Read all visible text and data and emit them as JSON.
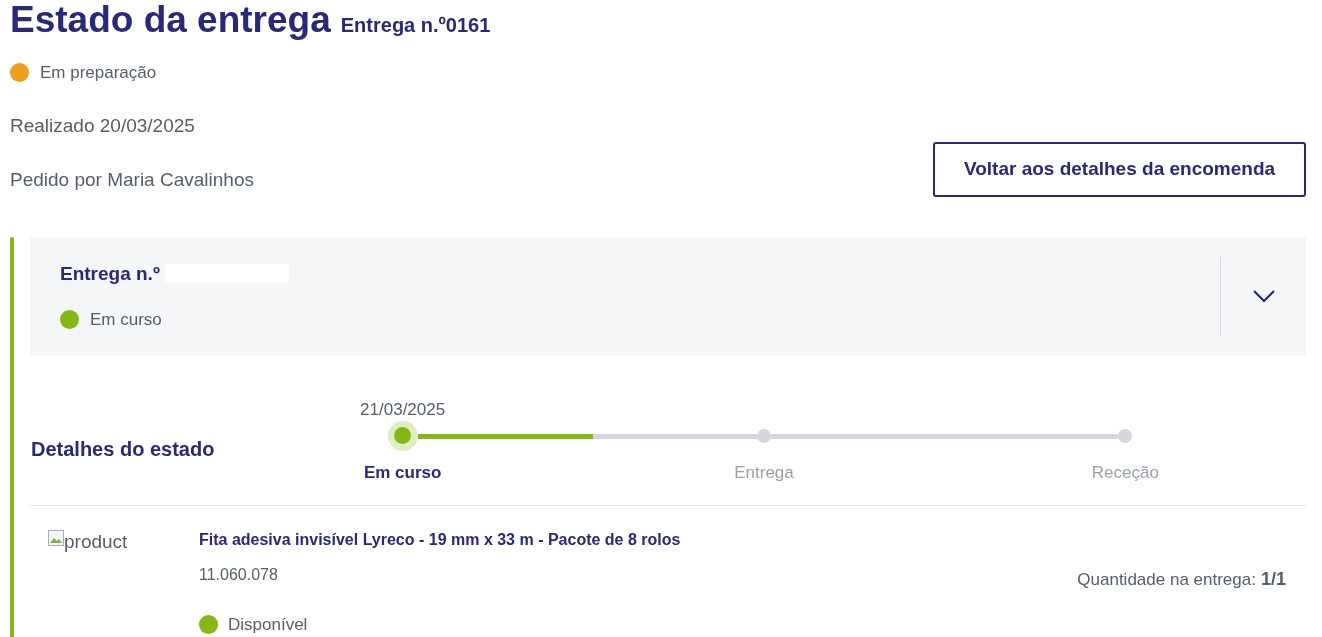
{
  "header": {
    "title": "Estado da entrega",
    "subtitle": "Entrega n.º0161",
    "status": {
      "label": "Em preparação",
      "color": "#f0a01a"
    },
    "placed": "Realizado 20/03/2025",
    "ordered_by": "Pedido por Maria Cavalinhos",
    "back_button": "Voltar aos detalhes da encomenda"
  },
  "delivery": {
    "title": "Entrega n.º",
    "redacted": true,
    "expanded": false,
    "status": {
      "label": "Em curso",
      "color": "#84b817"
    },
    "status_details": {
      "label": "Detalhes do estado",
      "level": 0.25,
      "steps": [
        {
          "label": "Em curso",
          "date": "21/03/2025",
          "selected": true
        },
        {
          "label": "Entrega",
          "selected": false
        },
        {
          "label": "Receção",
          "selected": false
        }
      ]
    },
    "products": [
      {
        "image_alt": "product",
        "name": "Fita adesiva invisível Lyreco - 19 mm x 33 m - Pacote de 8 rolos",
        "sku": "11.060.078",
        "availability": {
          "label": "Disponível",
          "color": "#84b817"
        },
        "quantity_label": "Quantidade na entrega:",
        "quantity": "1/1"
      }
    ]
  }
}
